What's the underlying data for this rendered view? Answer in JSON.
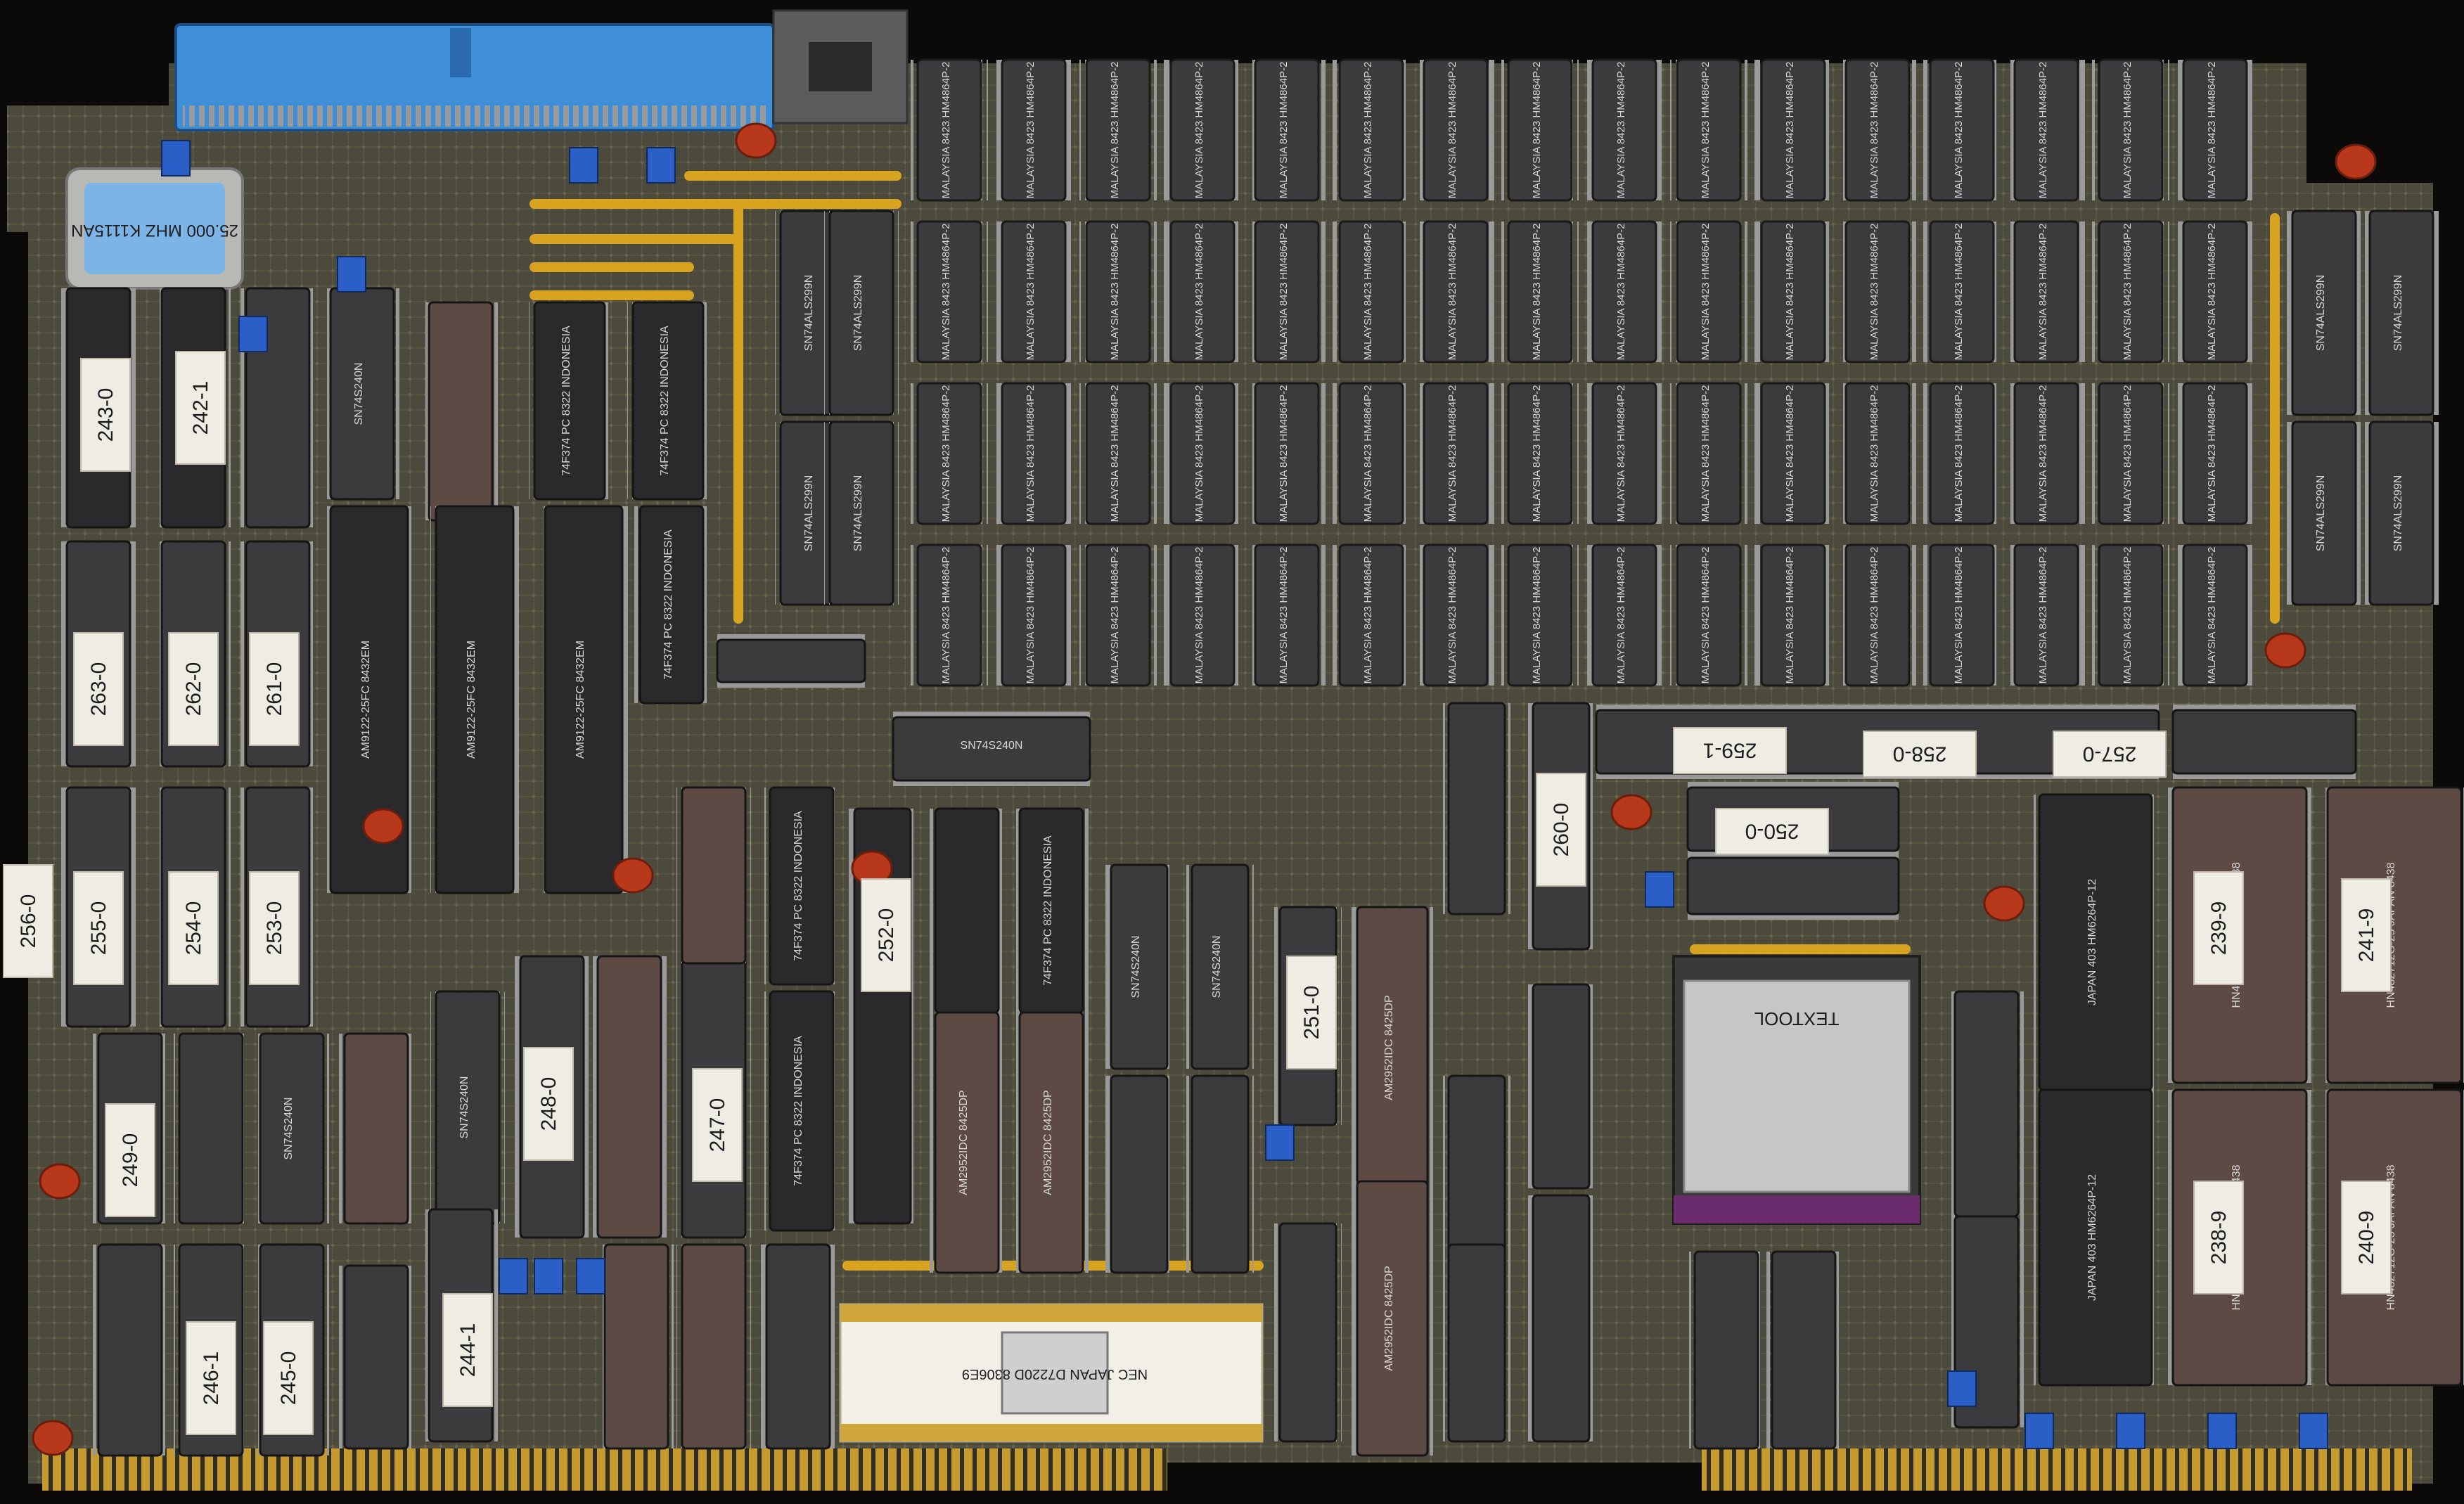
{
  "colors": {
    "pcb": "#4b4a3c",
    "pcb_dark": "#2f2e26",
    "chip_black": "#2a2a2c",
    "chip_grey": "#3b3b3e",
    "chip_brown": "#5e4a44",
    "label_white": "#efece4",
    "connector_blue": "#3f8fd8",
    "gold": "#c79a2d",
    "wire_yellow": "#d8a31f",
    "cap_red": "#b8381b",
    "jumper_blue": "#2a5fc8"
  },
  "logic_labels": [
    "243-0",
    "242-1",
    "263-0",
    "262-0",
    "261-0",
    "256-0",
    "255-0",
    "254-0",
    "253-0",
    "249-0",
    "248-0",
    "247-0",
    "246-1",
    "245-0",
    "244-1",
    "252-0",
    "251-0",
    "260-0",
    "259-1",
    "258-0",
    "257-0",
    "250-0",
    "239-9",
    "241-9",
    "238-9",
    "240-9"
  ],
  "chip_markings": {
    "ram": "MALAYSIA 8423 HM4864P-2",
    "pal": "AM9122-25FC 8432EM",
    "flipflop": "74F374 PC 8322 INDONESIA",
    "mux": "SN74ALS299N",
    "driver": "SN74S240N",
    "counter": "AM2952IDC 8425DP",
    "sram": "JAPAN 403 HM6264P-12",
    "rom": "HN482712G-25 JAPAN 8438",
    "nec": "NEC JAPAN D7220D 8306E9",
    "crystal": "25.000 MHZ K1115AN",
    "socket": "TEXTOOL"
  }
}
